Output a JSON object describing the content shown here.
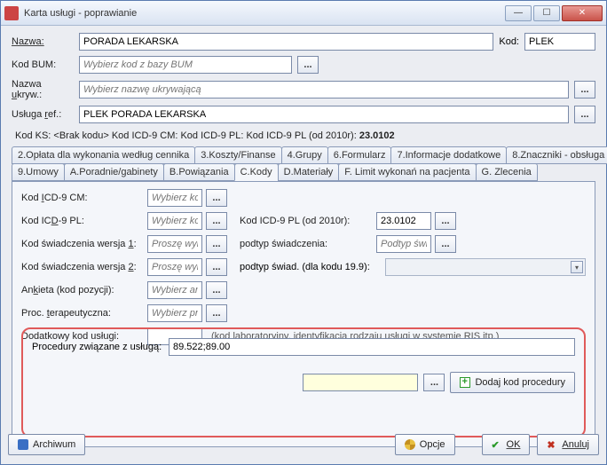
{
  "window": {
    "title": "Karta usługi - poprawianie"
  },
  "form": {
    "nazwa_label": "Nazwa:",
    "nazwa_value": "PORADA LEKARSKA",
    "kod_label": "Kod:",
    "kod_value": "PLEK",
    "kodbum_label": "Kod BUM:",
    "kodbum_ph": "Wybierz kod z bazy BUM",
    "ukryw_label": "Nazwa ukryw.:",
    "ukryw_ph": "Wybierz nazwę ukrywającą",
    "uslref_label": "Usługa ref.:",
    "uslref_value": "PLEK PORADA LEKARSKA",
    "kodline_prefix": "Kod KS: <Brak kodu>  Kod ICD-9 CM:    Kod ICD-9 PL:    Kod ICD-9 PL (od 2010r): ",
    "kodline_bold": "23.0102"
  },
  "tabs_row1": [
    "2.Opłata dla wykonania według cennika",
    "3.Koszty/Finanse",
    "4.Grupy",
    "6.Formularz",
    "7.Informacje dodatkowe",
    "8.Znaczniki - obsługa"
  ],
  "tabs_row2": [
    "9.Umowy",
    "A.Poradnie/gabinety",
    "B.Powiązania",
    "C.Kody",
    "D.Materiały",
    "F. Limit wykonań na pacjenta",
    "G. Zlecenia"
  ],
  "panel": {
    "icd9cm_label": "Kod ICD-9 CM:",
    "icd9cm_ph": "Wybierz ko...",
    "icd9pl_label": "Kod ICD-9 PL:",
    "icd9pl_ph": "Wybierz kod",
    "icd9pl2010_label": "Kod ICD-9 PL (od 2010r):",
    "icd9pl2010_value": "23.0102",
    "sw1_label": "Kod świadczenia wersja 1:",
    "sw1_ph": "Proszę wyb...",
    "podtyp_label": "podtyp świadczenia:",
    "podtyp_ph": "Podtyp świ...",
    "sw2_label": "Kod świadczenia wersja 2:",
    "sw2_ph": "Proszę wyb...",
    "podtyp199_label": "podtyp świad. (dla kodu 19.9):",
    "ankieta_label": "Ankieta (kod pozycji):",
    "ankieta_ph": "Wybierz an...",
    "proc_label": "Proc. terapeutyczna:",
    "proc_ph": "Wybierz pro...",
    "dod_label": "Dodatkowy kod usługi:",
    "dod_note": "(kod laboratoryjny, identyfikacja rodzaju usługi w systemie RIS itp.)",
    "procrel_label": "Procedury związane z usługą:",
    "procrel_value": "89.522;89.00",
    "addproc_label": "Dodaj kod procedury"
  },
  "footer": {
    "archiwum": "Archiwum",
    "opcje": "Opcje",
    "ok": "OK",
    "anuluj": "Anuluj"
  }
}
